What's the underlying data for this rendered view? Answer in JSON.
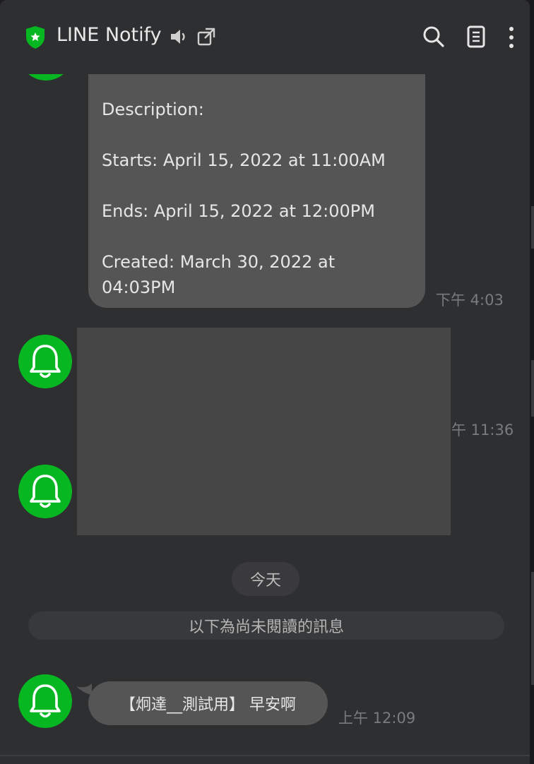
{
  "header": {
    "title": "LINE Notify"
  },
  "messages": {
    "first": {
      "line1": "Description:",
      "line2": "Starts: April 15, 2022 at 11:00AM",
      "line3": "Ends: April 15, 2022 at 12:00PM",
      "line4": "Created: March 30, 2022 at",
      "line5": "04:03PM",
      "time": "下午 4:03"
    },
    "second": {
      "time": "午 11:36"
    },
    "last": {
      "text": "【炯達__測試用】 早安啊",
      "time": "上午 12:09"
    }
  },
  "date_separator": "今天",
  "unread_divider": "以下為尚未閱讀的訊息",
  "colors": {
    "brand_green": "#06b722",
    "bubble": "#555556",
    "background": "#2e2f31"
  },
  "icons": [
    "shield-icon",
    "speaker-icon",
    "external-window-icon",
    "search-icon",
    "notes-icon",
    "more-icon",
    "bell-icon"
  ]
}
